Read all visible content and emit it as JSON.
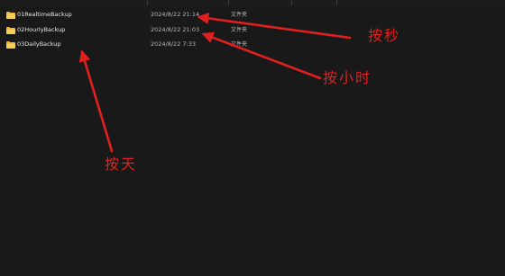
{
  "rows": [
    {
      "name": "01RealtimeBackup",
      "date": "2024/8/22 21:14",
      "type": "文件夹"
    },
    {
      "name": "02HourlyBackup",
      "date": "2024/8/22 21:03",
      "type": "文件夹"
    },
    {
      "name": "03DailyBackup",
      "date": "2024/8/22 7:33",
      "type": "文件夹"
    }
  ],
  "annotations": {
    "by_second": "按秒",
    "by_hour": "按小时",
    "by_day": "按天"
  },
  "colors": {
    "background": "#191919",
    "folder": "#f2c44a",
    "annotation": "#e0201e"
  },
  "icons": {
    "folder": "folder-icon"
  }
}
